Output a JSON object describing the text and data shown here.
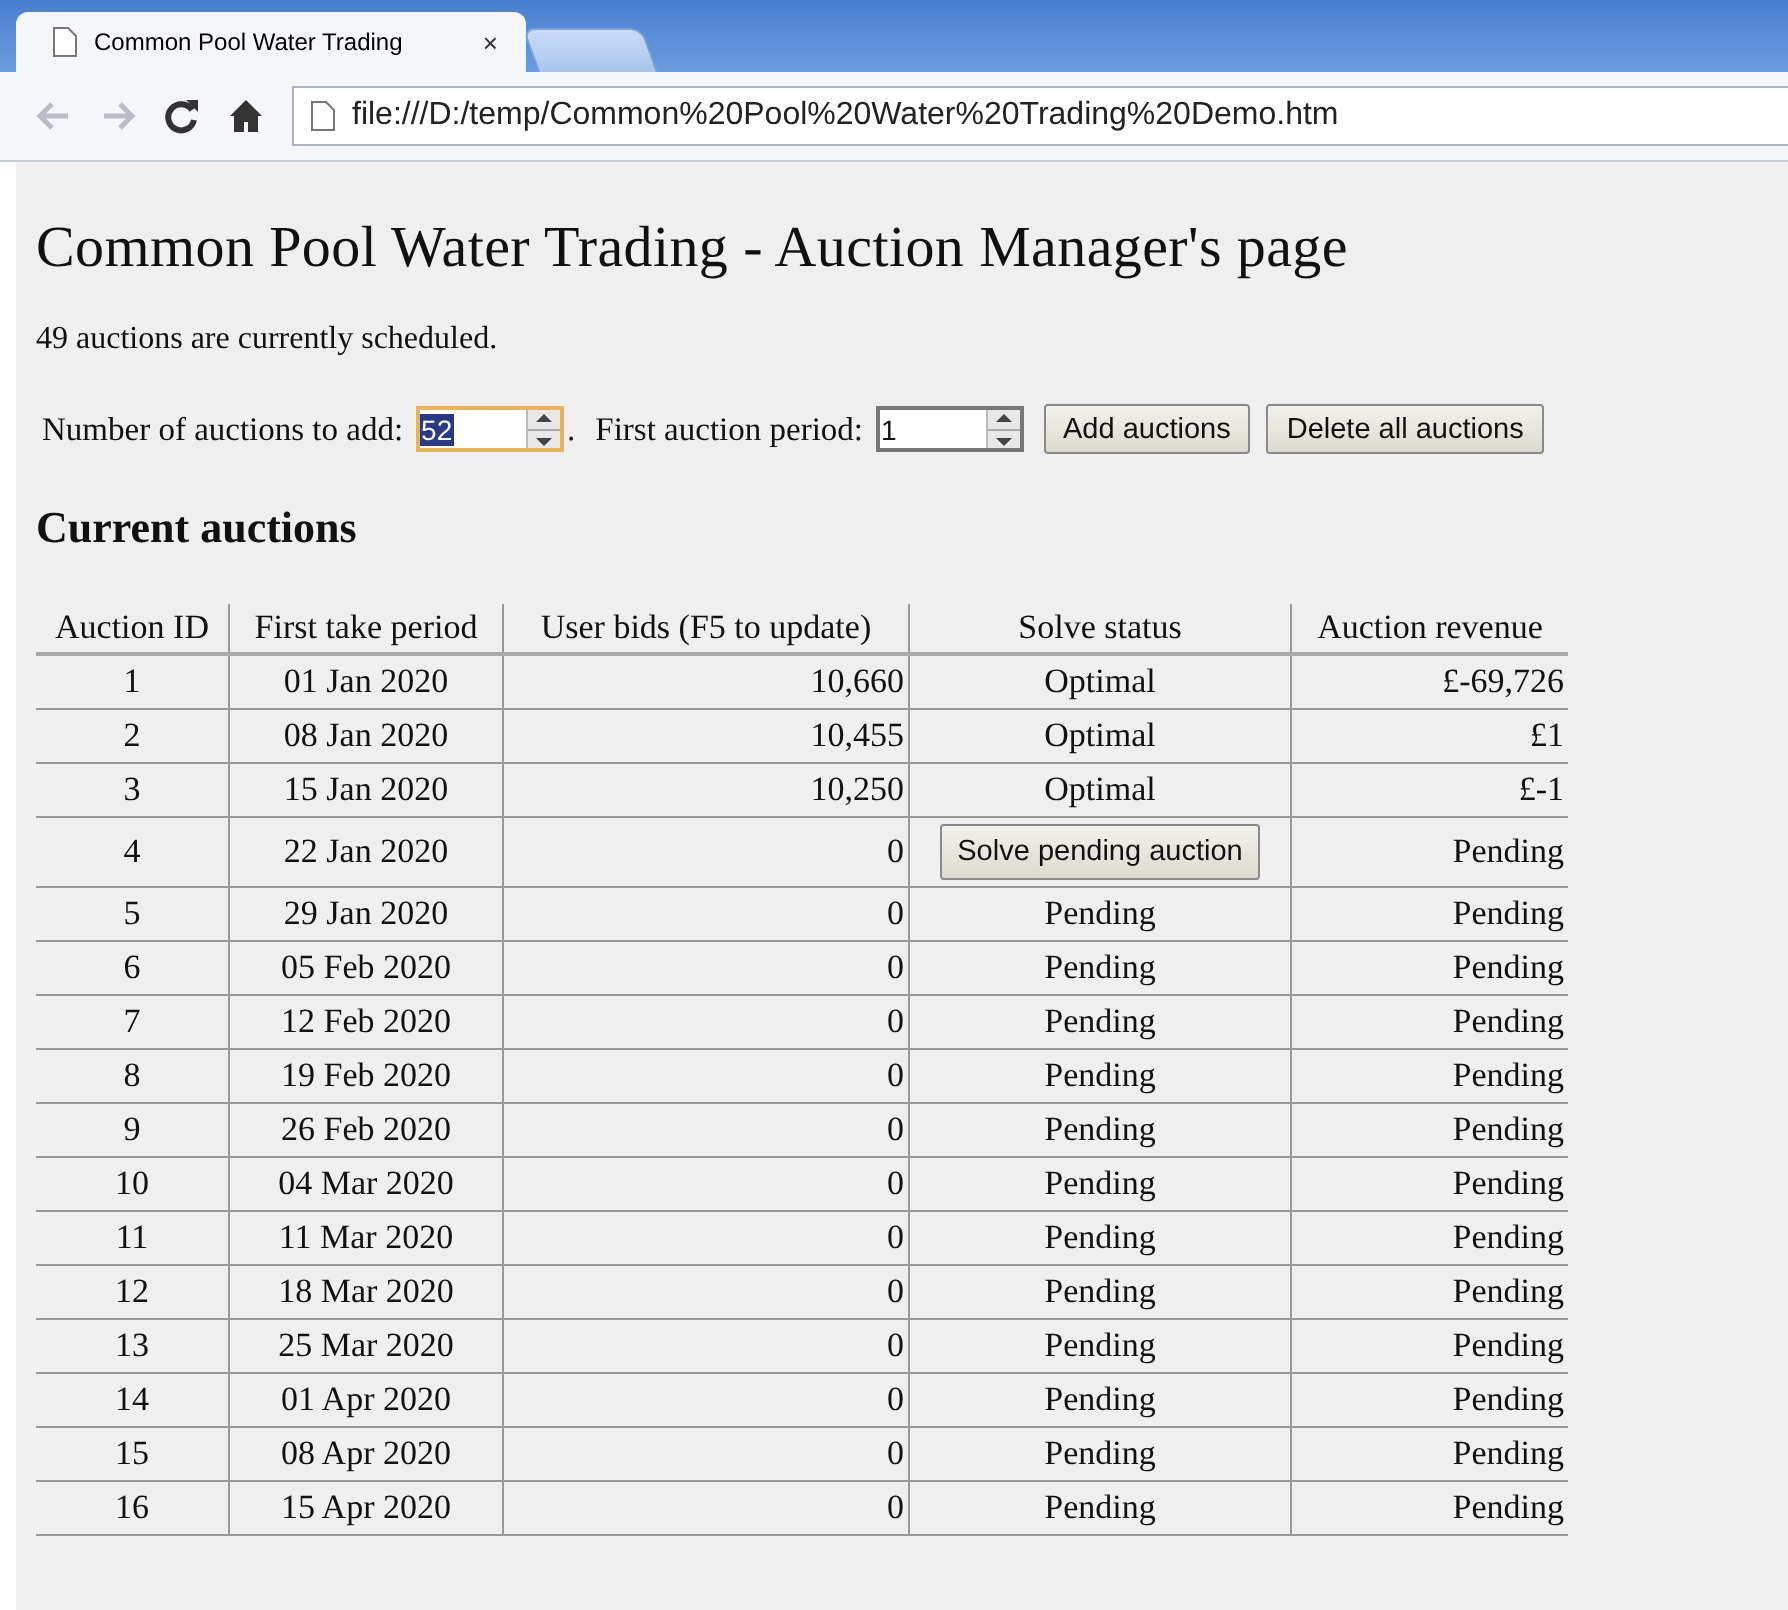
{
  "browser": {
    "tabs": [
      {
        "title": "Common Pool Water Trading",
        "selected": true,
        "close": "×"
      },
      {
        "selected": false
      }
    ],
    "address": "file:///D:/temp/Common%20Pool%20Water%20Trading%20Demo.htm",
    "back_disabled": true,
    "forward_disabled": true
  },
  "page": {
    "title": "Common Pool Water Trading - Auction Manager's page",
    "summary": "49 auctions are currently scheduled.",
    "controls": [
      {
        "kind": "spinner",
        "label": "Number of auctions to add:",
        "value": "52",
        "focused": true,
        "suffix": "."
      },
      {
        "kind": "spinner",
        "label": "First auction period:",
        "value": "1",
        "focused": false
      },
      {
        "kind": "button",
        "label": "Add auctions"
      },
      {
        "kind": "button",
        "label": "Delete all auctions"
      }
    ],
    "section_title": "Current auctions",
    "table": {
      "columns": [
        "Auction ID",
        "First take period",
        "User bids (F5 to update)",
        "Solve status",
        "Auction revenue"
      ],
      "rows": [
        {
          "id": "1",
          "period": "01 Jan 2020",
          "bids": "10,660",
          "status": {
            "kind": "text",
            "text": "Optimal"
          },
          "revenue": "£-69,726"
        },
        {
          "id": "2",
          "period": "08 Jan 2020",
          "bids": "10,455",
          "status": {
            "kind": "text",
            "text": "Optimal"
          },
          "revenue": "£1"
        },
        {
          "id": "3",
          "period": "15 Jan 2020",
          "bids": "10,250",
          "status": {
            "kind": "text",
            "text": "Optimal"
          },
          "revenue": "£-1"
        },
        {
          "id": "4",
          "period": "22 Jan 2020",
          "bids": "0",
          "status": {
            "kind": "button",
            "text": "Solve pending auction"
          },
          "revenue": "Pending"
        },
        {
          "id": "5",
          "period": "29 Jan 2020",
          "bids": "0",
          "status": {
            "kind": "text",
            "text": "Pending"
          },
          "revenue": "Pending"
        },
        {
          "id": "6",
          "period": "05 Feb 2020",
          "bids": "0",
          "status": {
            "kind": "text",
            "text": "Pending"
          },
          "revenue": "Pending"
        },
        {
          "id": "7",
          "period": "12 Feb 2020",
          "bids": "0",
          "status": {
            "kind": "text",
            "text": "Pending"
          },
          "revenue": "Pending"
        },
        {
          "id": "8",
          "period": "19 Feb 2020",
          "bids": "0",
          "status": {
            "kind": "text",
            "text": "Pending"
          },
          "revenue": "Pending"
        },
        {
          "id": "9",
          "period": "26 Feb 2020",
          "bids": "0",
          "status": {
            "kind": "text",
            "text": "Pending"
          },
          "revenue": "Pending"
        },
        {
          "id": "10",
          "period": "04 Mar 2020",
          "bids": "0",
          "status": {
            "kind": "text",
            "text": "Pending"
          },
          "revenue": "Pending"
        },
        {
          "id": "11",
          "period": "11 Mar 2020",
          "bids": "0",
          "status": {
            "kind": "text",
            "text": "Pending"
          },
          "revenue": "Pending"
        },
        {
          "id": "12",
          "period": "18 Mar 2020",
          "bids": "0",
          "status": {
            "kind": "text",
            "text": "Pending"
          },
          "revenue": "Pending"
        },
        {
          "id": "13",
          "period": "25 Mar 2020",
          "bids": "0",
          "status": {
            "kind": "text",
            "text": "Pending"
          },
          "revenue": "Pending"
        },
        {
          "id": "14",
          "period": "01 Apr 2020",
          "bids": "0",
          "status": {
            "kind": "text",
            "text": "Pending"
          },
          "revenue": "Pending"
        },
        {
          "id": "15",
          "period": "08 Apr 2020",
          "bids": "0",
          "status": {
            "kind": "text",
            "text": "Pending"
          },
          "revenue": "Pending"
        },
        {
          "id": "16",
          "period": "15 Apr 2020",
          "bids": "0",
          "status": {
            "kind": "text",
            "text": "Pending"
          },
          "revenue": "Pending"
        }
      ]
    }
  }
}
